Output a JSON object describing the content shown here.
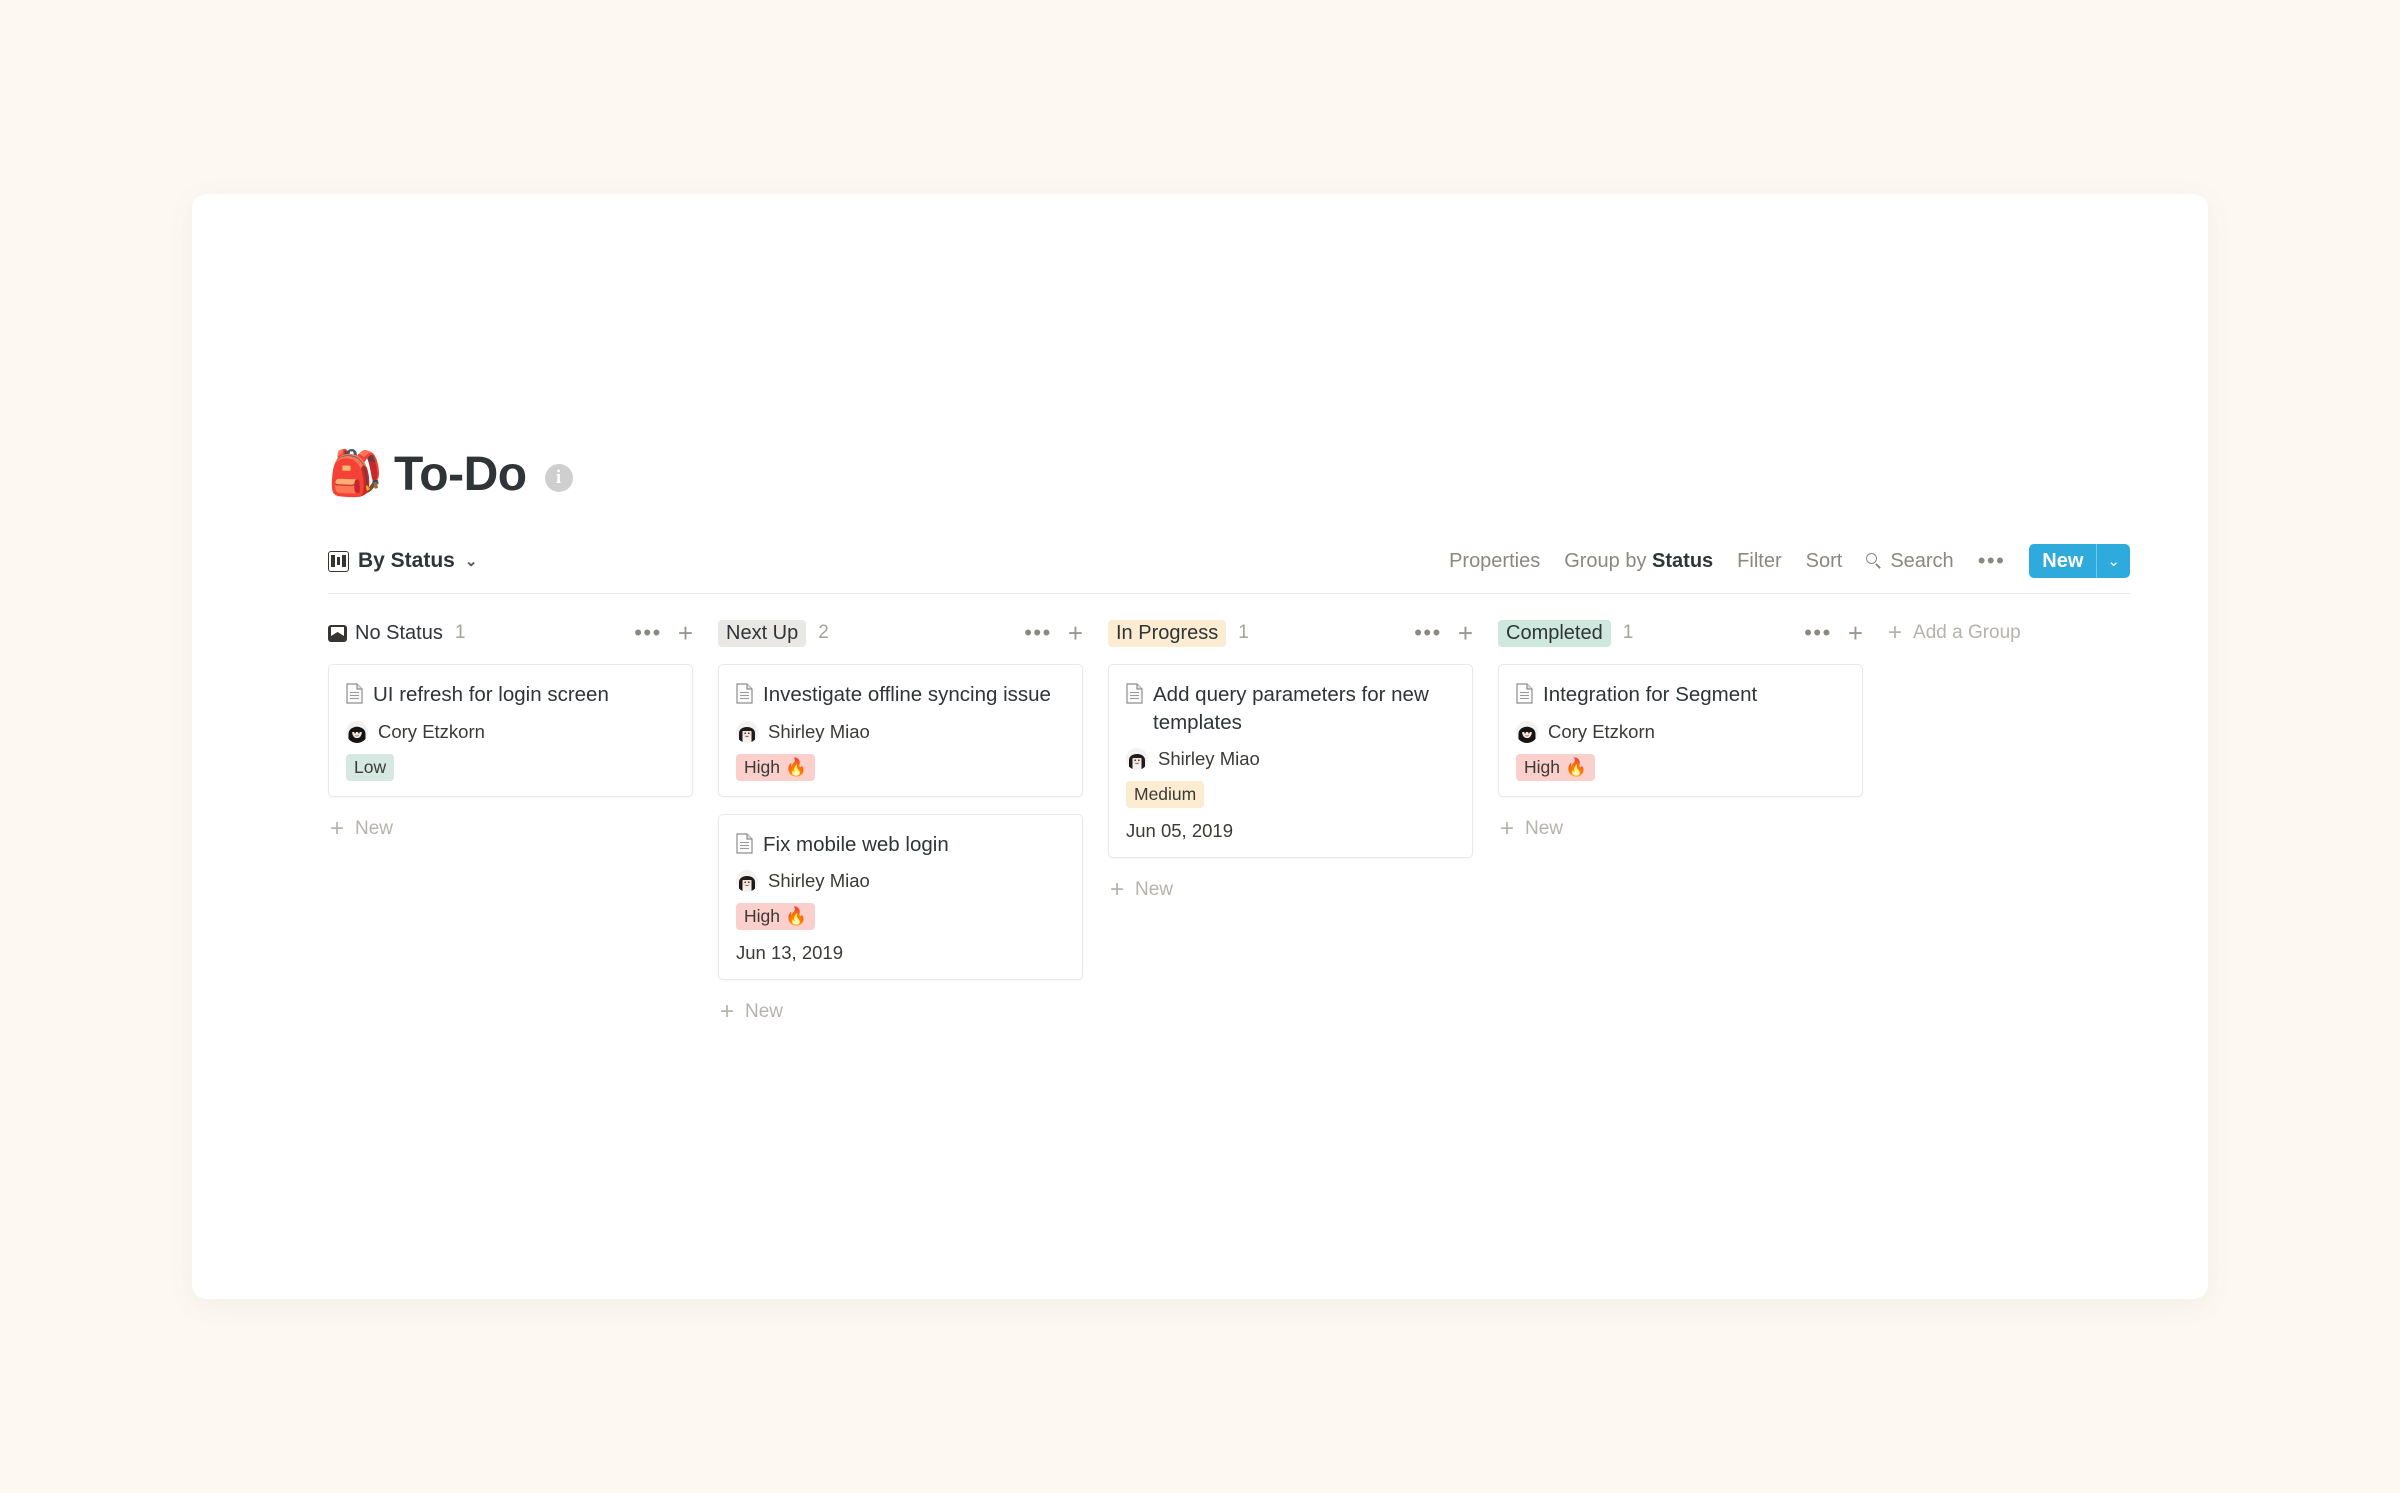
{
  "page": {
    "emoji": "🎒",
    "title": "To-Do",
    "info_icon": "i"
  },
  "view": {
    "label": "By Status",
    "chevron": "⌄"
  },
  "toolbar": {
    "properties": "Properties",
    "group_by_prefix": "Group by ",
    "group_by_value": "Status",
    "filter": "Filter",
    "sort": "Sort",
    "search": "Search",
    "more": "•••",
    "new_label": "New",
    "new_caret": "⌄"
  },
  "board": {
    "add_group": "Add a Group",
    "add_group_plus": "+",
    "new_label": "New",
    "new_plus": "+",
    "col_more": "•••",
    "col_plus": "+",
    "columns": [
      {
        "name": "No Status",
        "count": "1",
        "pill": false,
        "pill_bg": "",
        "icon": "tray-icon",
        "cards": [
          {
            "title": "UI refresh for login screen",
            "person": "Cory Etzkorn",
            "avatar": "cory",
            "tag": "Low",
            "tag_emoji": "",
            "tag_bg": "#d6e8e2",
            "date": ""
          }
        ]
      },
      {
        "name": "Next Up",
        "count": "2",
        "pill": true,
        "pill_bg": "#e9e8e5",
        "icon": "",
        "cards": [
          {
            "title": "Investigate offline syncing issue",
            "person": "Shirley Miao",
            "avatar": "shirley",
            "tag": "High",
            "tag_emoji": "🔥",
            "tag_bg": "#fbcfcc",
            "date": ""
          },
          {
            "title": "Fix mobile web login",
            "person": "Shirley Miao",
            "avatar": "shirley",
            "tag": "High",
            "tag_emoji": "🔥",
            "tag_bg": "#fbcfcc",
            "date": "Jun 13, 2019"
          }
        ]
      },
      {
        "name": "In Progress",
        "count": "1",
        "pill": true,
        "pill_bg": "#fbecd2",
        "icon": "",
        "cards": [
          {
            "title": "Add query parameters for new templates",
            "person": "Shirley Miao",
            "avatar": "shirley",
            "tag": "Medium",
            "tag_emoji": "",
            "tag_bg": "#fbecd2",
            "date": "Jun 05, 2019"
          }
        ]
      },
      {
        "name": "Completed",
        "count": "1",
        "pill": true,
        "pill_bg": "#cfe8de",
        "icon": "",
        "cards": [
          {
            "title": "Integration for Segment",
            "person": "Cory Etzkorn",
            "avatar": "cory",
            "tag": "High",
            "tag_emoji": "🔥",
            "tag_bg": "#fbcfcc",
            "date": ""
          }
        ]
      }
    ]
  },
  "colors": {
    "accent": "#2eaadc",
    "background": "#fdf8f2",
    "surface": "#ffffff",
    "text": "#2f3437",
    "muted": "#8b8781"
  }
}
